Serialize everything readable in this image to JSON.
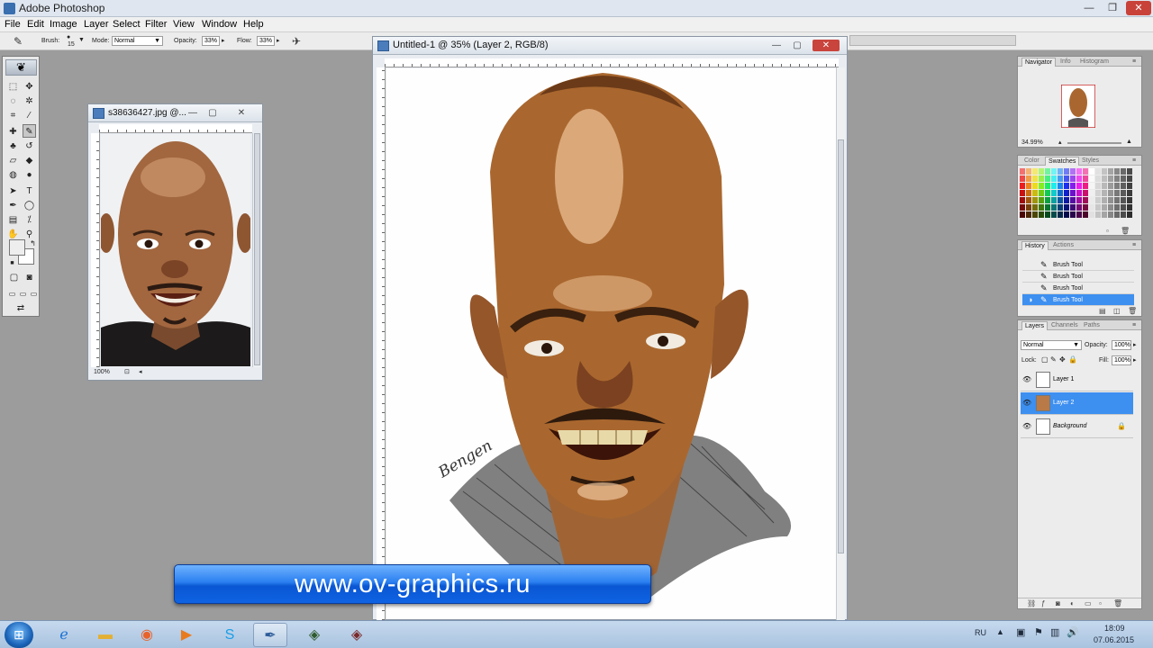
{
  "app": {
    "title": "Adobe Photoshop",
    "window_controls": {
      "minimize": "—",
      "restore": "❐",
      "close": "✕"
    }
  },
  "menu": [
    "File",
    "Edit",
    "Image",
    "Layer",
    "Select",
    "Filter",
    "View",
    "Window",
    "Help"
  ],
  "options_bar": {
    "brush_label": "Brush:",
    "brush_size": "15",
    "mode_label": "Mode:",
    "mode_value": "Normal",
    "opacity_label": "Opacity:",
    "opacity_value": "33%",
    "flow_label": "Flow:",
    "flow_value": "33%"
  },
  "photo_doc": {
    "title": "s38636427.jpg @...",
    "zoom": "100%"
  },
  "main_doc": {
    "title": "Untitled-1 @ 35% (Layer 2, RGB/8)",
    "signature": "Bengen"
  },
  "navigator": {
    "tabs": [
      "Navigator",
      "Info",
      "Histogram"
    ],
    "zoom": "34.99%"
  },
  "color_panel": {
    "tabs": [
      "Color",
      "Swatches",
      "Styles"
    ]
  },
  "history": {
    "tabs": [
      "History",
      "Actions"
    ],
    "items": [
      "Brush Tool",
      "Brush Tool",
      "Brush Tool",
      "Brush Tool"
    ]
  },
  "layers": {
    "tabs": [
      "Layers",
      "Channels",
      "Paths"
    ],
    "blend_mode": "Normal",
    "opacity_label": "Opacity:",
    "opacity_value": "100%",
    "lock_label": "Lock:",
    "fill_label": "Fill:",
    "fill_value": "100%",
    "items": [
      "Layer 1",
      "Layer 2",
      "Background"
    ]
  },
  "banner": {
    "text": "www.ov-graphics.ru"
  },
  "taskbar": {
    "language": "RU",
    "time": "18:09",
    "date": "07.06.2015"
  },
  "colors": {
    "selection_blue": "#3d8ff0",
    "banner_blue": "#1f6fe8",
    "workspace_gray": "#9c9c9c"
  }
}
